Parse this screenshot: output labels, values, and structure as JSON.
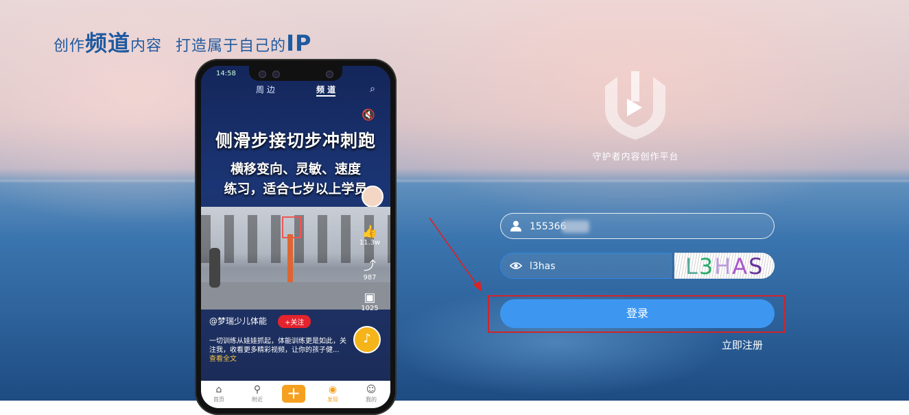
{
  "slogan": {
    "part1": "创作",
    "part1_bold": "频道",
    "part1_end": "内容",
    "part2": "打造属于自己的",
    "part2_bold": "IP"
  },
  "phone": {
    "status_time": "14:58",
    "nav": {
      "nearby": "周 边",
      "channel": "频 道"
    },
    "video_title": "侧滑步接切步冲刺跑",
    "video_subtitle_1": "横移变向、灵敏、速度",
    "video_subtitle_2": "练习，适合七岁以上学员",
    "likes": "11.3w",
    "shares": "987",
    "comments": "1025",
    "author": "@梦瑞少儿体能",
    "follow_label": "+关注",
    "caption": "一切训练从娃娃抓起，体能训练更是如此，关注我，收看更多精彩视频，让你的孩子健...",
    "caption_more": "查看全文",
    "tabs": [
      "首页",
      "附近",
      "发现",
      "我的"
    ]
  },
  "platform": {
    "name": "守护者内容创作平台"
  },
  "login": {
    "username_value": "155366",
    "password_value": "l3has",
    "captcha_text": "L3HAS",
    "login_label": "登录",
    "register_label": "立即注册"
  },
  "colors": {
    "accent": "#3d97f0",
    "highlight": "#d0242a",
    "slogan": "#1f5aa0"
  }
}
